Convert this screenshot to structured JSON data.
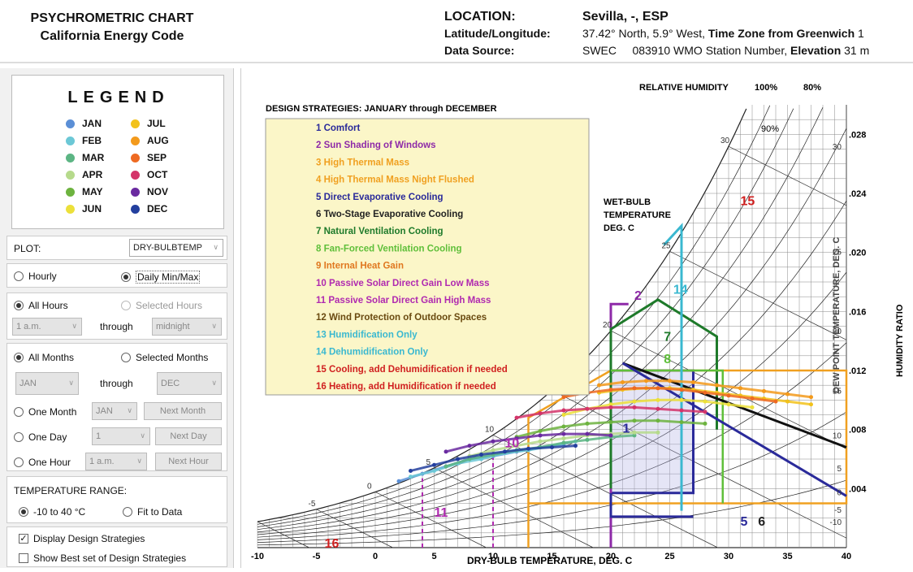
{
  "header": {
    "title1": "PSYCHROMETRIC CHART",
    "title2": "California Energy Code",
    "location_label": "LOCATION:",
    "location_value": "Sevilla, -, ESP",
    "latlon_label": "Latitude/Longitude:",
    "latlon_value": "37.42° North, 5.9° West,",
    "tz_label": "Time Zone from Greenwich",
    "tz_value": "1",
    "source_label": "Data Source:",
    "source_value": "SWEC     083910 WMO Station Number,",
    "elev_label": "Elevation",
    "elev_value": "31 m"
  },
  "legend": {
    "title": "LEGEND",
    "months": [
      {
        "label": "JAN",
        "color": "#5b8fd6"
      },
      {
        "label": "JUL",
        "color": "#f2c21b"
      },
      {
        "label": "FEB",
        "color": "#6cc8d6"
      },
      {
        "label": "AUG",
        "color": "#f39a1c"
      },
      {
        "label": "MAR",
        "color": "#5cb584"
      },
      {
        "label": "SEP",
        "color": "#ee6a22"
      },
      {
        "label": "APR",
        "color": "#b6da8c"
      },
      {
        "label": "OCT",
        "color": "#d4346a"
      },
      {
        "label": "MAY",
        "color": "#6db33f"
      },
      {
        "label": "NOV",
        "color": "#6a2aa0"
      },
      {
        "label": "JUN",
        "color": "#ece03a"
      },
      {
        "label": "DEC",
        "color": "#233f9e"
      }
    ]
  },
  "controls": {
    "plot_label": "PLOT:",
    "plot_value": "DRY-BULBTEMP",
    "hourly": "Hourly",
    "daily": "Daily Min/Max",
    "all_hours": "All Hours",
    "selected_hours": "Selected Hours",
    "hour_from": "1 a.m.",
    "through": "through",
    "hour_to": "midnight",
    "all_months": "All Months",
    "selected_months": "Selected Months",
    "month_from": "JAN",
    "month_to": "DEC",
    "one_month": "One Month",
    "one_month_val": "JAN",
    "next_month": "Next Month",
    "one_day": "One Day",
    "one_day_val": "1",
    "next_day": "Next Day",
    "one_hour": "One Hour",
    "one_hour_val": "1 a.m.",
    "next_hour": "Next Hour",
    "temp_range_label": "TEMPERATURE RANGE:",
    "range_opt1": "-10 to 40 °C",
    "range_opt2": "Fit to Data",
    "display_strategies": "Display Design Strategies",
    "show_best": "Show Best set of Design Strategies"
  },
  "chart_data": {
    "type": "scatter",
    "title": "DESIGN STRATEGIES:  JANUARY through DECEMBER",
    "xlabel": "DRY-BULB TEMPERATURE, DEG. C",
    "ylabel": "HUMIDITY RATIO",
    "ylabel2": "DEW POINT TEMPERATURE, DEG. C",
    "rh_label": "RELATIVE HUMIDITY",
    "rh_100": "100%",
    "rh_80": "80%",
    "rh_90_label": "90%",
    "wb_label": [
      "WET-BULB",
      "TEMPERATURE",
      "DEG. C"
    ],
    "xlim": [
      -10,
      40
    ],
    "ylim": [
      0,
      0.03
    ],
    "x_ticks": [
      "-10",
      "-5",
      "0",
      "5",
      "10",
      "15",
      "20",
      "25",
      "30",
      "35",
      "40"
    ],
    "y_ticks": [
      ".004",
      ".008",
      ".012",
      ".016",
      ".020",
      ".024",
      ".028"
    ],
    "dew_ticks": [
      "-10",
      "-5",
      "0",
      "5",
      "10",
      "15",
      "20",
      "25",
      "30"
    ],
    "wb_ticks": [
      "-5",
      "0",
      "5",
      "10",
      "15",
      "20",
      "25",
      "30"
    ],
    "strategies": [
      {
        "label": "1 Comfort",
        "color": "#2a2a9a"
      },
      {
        "label": "2 Sun Shading of Windows",
        "color": "#8e2aa8"
      },
      {
        "label": "3 High Thermal Mass",
        "color": "#f0a020"
      },
      {
        "label": "4 High Thermal Mass Night Flushed",
        "color": "#f0a020"
      },
      {
        "label": "5 Direct Evaporative Cooling",
        "color": "#2a2a9a"
      },
      {
        "label": "6 Two-Stage Evaporative Cooling",
        "color": "#222222"
      },
      {
        "label": "7 Natural Ventilation Cooling",
        "color": "#1e7a2a"
      },
      {
        "label": "8 Fan-Forced Ventilation Cooling",
        "color": "#5fbf3a"
      },
      {
        "label": "9 Internal Heat Gain",
        "color": "#e07820"
      },
      {
        "label": "10 Passive Solar Direct Gain Low Mass",
        "color": "#b02ab0"
      },
      {
        "label": "11 Passive Solar Direct Gain High Mass",
        "color": "#b02ab0"
      },
      {
        "label": "12 Wind Protection of Outdoor Spaces",
        "color": "#6a4a10"
      },
      {
        "label": "13 Humidification Only",
        "color": "#3ab8d0"
      },
      {
        "label": "14 Dehumidification Only",
        "color": "#3ab8d0"
      },
      {
        "label": "15 Cooling, add Dehumidification if needed",
        "color": "#d02020"
      },
      {
        "label": "16 Heating, add Humidification if needed",
        "color": "#d02020"
      }
    ],
    "zone_labels": {
      "z1": "1",
      "z2": "2",
      "z5": "5",
      "z6": "6",
      "z7": "7",
      "z8": "8",
      "z10": "10",
      "z11": "11",
      "z14": "14",
      "z15": "15",
      "z16": "16"
    },
    "series": [
      {
        "name": "JAN",
        "x": [
          2,
          4,
          6,
          8,
          10,
          12,
          14,
          16
        ],
        "y": [
          0.0045,
          0.005,
          0.0055,
          0.006,
          0.0062,
          0.0065,
          0.0068,
          0.007
        ]
      },
      {
        "name": "FEB",
        "x": [
          3,
          5,
          7,
          9,
          11,
          13,
          15,
          17
        ],
        "y": [
          0.0048,
          0.0052,
          0.0057,
          0.006,
          0.0064,
          0.0066,
          0.0069,
          0.0072
        ]
      },
      {
        "name": "MAR",
        "x": [
          6,
          8,
          10,
          12,
          14,
          16,
          18,
          20,
          22
        ],
        "y": [
          0.0055,
          0.006,
          0.0063,
          0.0066,
          0.0068,
          0.0071,
          0.0073,
          0.0075,
          0.0076
        ]
      },
      {
        "name": "APR",
        "x": [
          8,
          10,
          12,
          14,
          16,
          18,
          20,
          22,
          24
        ],
        "y": [
          0.0062,
          0.0066,
          0.0069,
          0.0072,
          0.0074,
          0.0076,
          0.0077,
          0.0078,
          0.0078
        ]
      },
      {
        "name": "MAY",
        "x": [
          12,
          14,
          16,
          18,
          20,
          22,
          24,
          26,
          28
        ],
        "y": [
          0.0075,
          0.0079,
          0.0082,
          0.0084,
          0.0085,
          0.0086,
          0.0086,
          0.0085,
          0.0084
        ]
      },
      {
        "name": "JUN",
        "x": [
          16,
          18,
          20,
          22,
          24,
          26,
          28,
          30,
          32
        ],
        "y": [
          0.009,
          0.0094,
          0.0097,
          0.0099,
          0.01,
          0.01,
          0.0099,
          0.0097,
          0.0095
        ]
      },
      {
        "name": "JUL",
        "x": [
          19,
          21,
          23,
          25,
          27,
          29,
          31,
          33,
          35,
          37
        ],
        "y": [
          0.0105,
          0.0107,
          0.0108,
          0.0108,
          0.0107,
          0.0105,
          0.0103,
          0.0101,
          0.0099,
          0.0097
        ]
      },
      {
        "name": "AUG",
        "x": [
          19,
          21,
          23,
          25,
          27,
          29,
          31,
          33,
          35,
          37
        ],
        "y": [
          0.011,
          0.0112,
          0.0113,
          0.0113,
          0.0112,
          0.011,
          0.0108,
          0.0106,
          0.0104,
          0.0102
        ]
      },
      {
        "name": "SEP",
        "x": [
          16,
          18,
          20,
          22,
          24,
          26,
          28,
          30,
          32,
          34
        ],
        "y": [
          0.0102,
          0.0105,
          0.0107,
          0.0108,
          0.0108,
          0.0107,
          0.0105,
          0.0103,
          0.0101,
          0.0099
        ]
      },
      {
        "name": "OCT",
        "x": [
          12,
          14,
          16,
          18,
          20,
          22,
          24,
          26,
          28
        ],
        "y": [
          0.0088,
          0.0091,
          0.0093,
          0.0094,
          0.0095,
          0.0095,
          0.0094,
          0.0093,
          0.0092
        ]
      },
      {
        "name": "NOV",
        "x": [
          6,
          8,
          10,
          12,
          14,
          16,
          18,
          20
        ],
        "y": [
          0.0065,
          0.0069,
          0.0072,
          0.0074,
          0.0076,
          0.0077,
          0.0077,
          0.0076
        ]
      },
      {
        "name": "DEC",
        "x": [
          3,
          5,
          7,
          9,
          11,
          13,
          15,
          17
        ],
        "y": [
          0.0052,
          0.0056,
          0.006,
          0.0063,
          0.0065,
          0.0067,
          0.0068,
          0.0069
        ]
      }
    ]
  }
}
